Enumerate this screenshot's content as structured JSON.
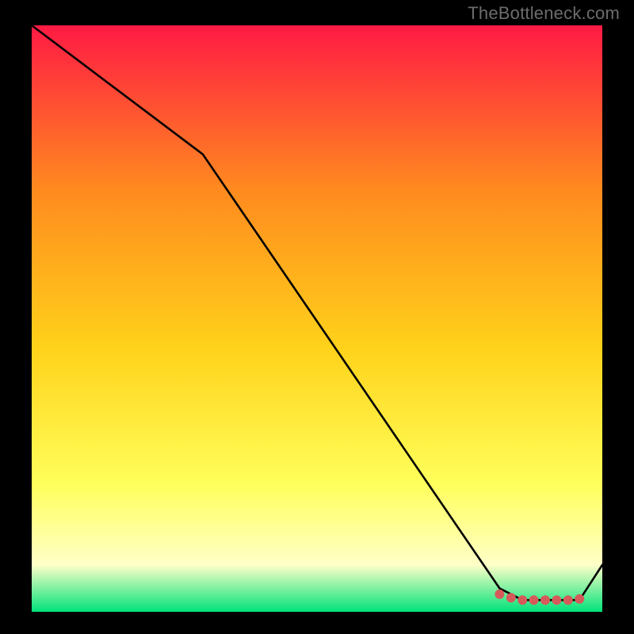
{
  "watermark": "TheBottleneck.com",
  "colors": {
    "background": "#000000",
    "gradient_top": "#ff1a44",
    "gradient_mid_upper": "#ff8a1f",
    "gradient_mid": "#ffd21a",
    "gradient_mid_lower": "#ffff5a",
    "gradient_pale": "#ffffc8",
    "gradient_bottom": "#00e27a",
    "line": "#000000",
    "marker": "#d65a5a"
  },
  "chart_data": {
    "type": "line",
    "title": "",
    "xlabel": "",
    "ylabel": "",
    "xlim": [
      0,
      100
    ],
    "ylim": [
      0,
      100
    ],
    "series": [
      {
        "name": "curve",
        "x": [
          0,
          30,
          82,
          86,
          90,
          93,
          96,
          100
        ],
        "y": [
          100,
          78,
          4,
          2,
          2,
          2,
          2,
          8
        ]
      }
    ],
    "markers": {
      "name": "bottom-cluster",
      "x": [
        82,
        84,
        86,
        88,
        90,
        92,
        94,
        96
      ],
      "y": [
        3.0,
        2.4,
        2.0,
        2.0,
        2.0,
        2.0,
        2.0,
        2.2
      ]
    }
  }
}
